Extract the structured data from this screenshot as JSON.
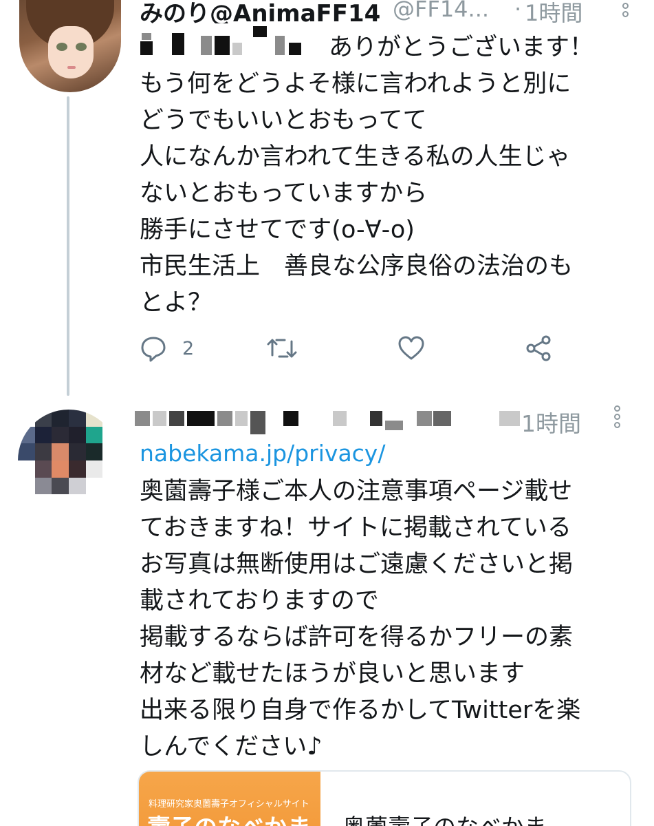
{
  "tweet1": {
    "display_name": "みのり@AnimaFF14",
    "handle": "@FF14...",
    "separator": "·",
    "time": "1時間",
    "text": "ありがとうございます！\nもう何をどうよそ様に言われようと別に\nどうでもいいとおもってて\n人になんか言われて生きる私の人生じゃ\nないとおもっていますから\n勝手にさせてです(o-∀-o)\n市民生活上　善良な公序良俗の法治のも\nとよ？",
    "reply_count": "2"
  },
  "tweet2": {
    "time": "1時間",
    "link": "nabekama.jp/privacy/",
    "text": "奥薗壽子様ご本人の注意事項ページ載せ\nておきますね！サイトに掲載されている\nお写真は無断使用はご遠慮くださいと掲\n載されておりますので\n掲載するならば許可を得るかフリーの素\n材など載せたほうが良いと思います\n出来る限り自身で作るかしてTwitterを楽\nしんでください♪",
    "card": {
      "image_subtitle": "料理研究家奥薗壽子オフィシャルサイト",
      "image_title": "壽子のなべかま",
      "title": "奥薗壽子のなべかま"
    }
  },
  "icons": {
    "reply": "reply-icon",
    "retweet": "retweet-icon",
    "like": "heart-icon",
    "share": "share-icon",
    "menu": "more-icon"
  },
  "colors": {
    "link": "#1b95e0",
    "muted": "#8e999f",
    "thread_line": "#c4cfd6"
  }
}
